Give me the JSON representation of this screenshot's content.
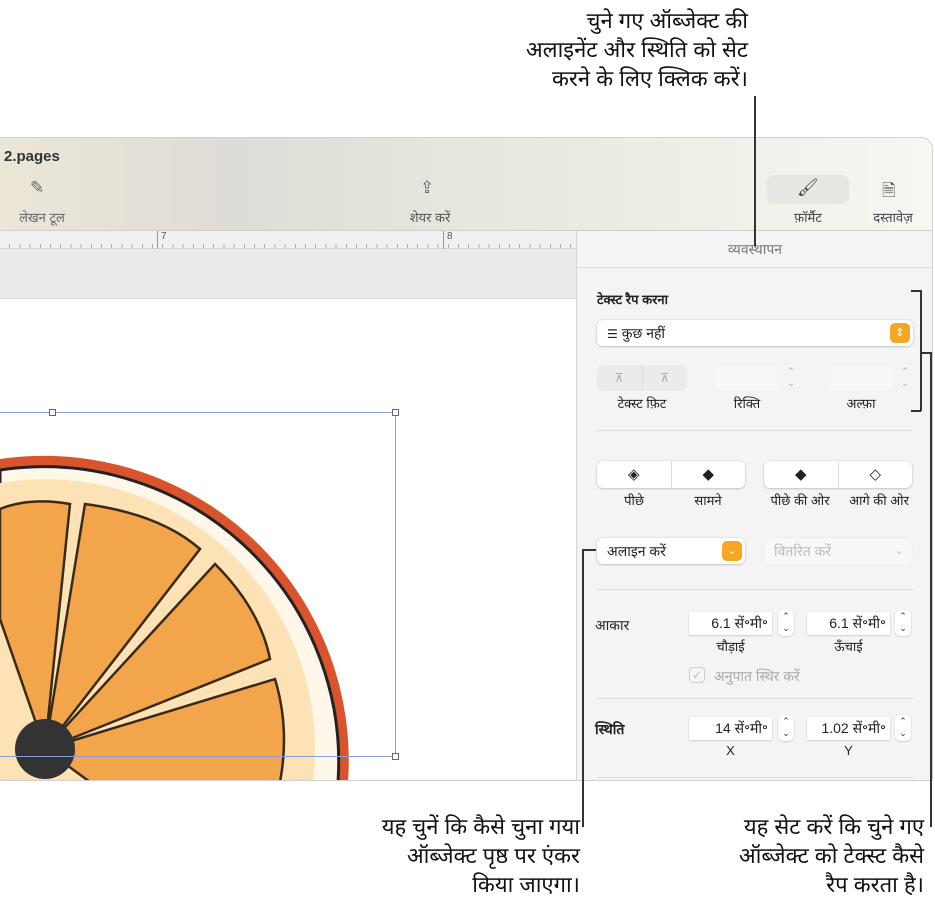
{
  "callouts": {
    "top": [
      "चुने गए ऑब्जेक्ट की",
      "अलाइनेंट और स्थिति को सेट",
      "करने के लिए क्लिक करें।"
    ],
    "bottom_left": [
      "यह चुनें कि कैसे चुना गया",
      "ऑब्जेक्ट पृष्ठ पर एंकर",
      "किया जाएगा।"
    ],
    "bottom_right": [
      "यह सेट करें कि चुने गए",
      "ऑब्जेक्ट को टेक्स्ट कैसे",
      "रैप करता है।"
    ]
  },
  "window": {
    "title": "2.pages"
  },
  "toolbar": {
    "writing_tools": "लेखन टूल",
    "share": "शेयर करें",
    "format": "फ़ॉर्मैट",
    "document": "दस्तावेज़"
  },
  "ruler": {
    "ticks": [
      "7",
      "8"
    ]
  },
  "sidebar": {
    "tab": "व्यवस्थापन",
    "text_wrap": {
      "heading": "टेक्स्ट रैप करना",
      "value": "कुछ नहीं",
      "text_fit": "टेक्स्ट फ़िट",
      "spacing": "रिक्ति",
      "alpha": "अल्फ़ा"
    },
    "arrange": {
      "back": "पीछे",
      "front": "सामने",
      "backward": "पीछे की ओर",
      "forward": "आगे की ओर"
    },
    "align": "अलाइन करें",
    "distribute": "वितरित करें",
    "size": {
      "label": "आकार",
      "width": "6.1 सें॰मी॰",
      "height": "6.1 सें॰मी॰",
      "width_label": "चौड़ाई",
      "height_label": "ऊँचाई",
      "constrain": "अनुपात स्थिर करें"
    },
    "position": {
      "label": "स्थिति",
      "x": "14 सें॰मी॰",
      "y": "1.02 सें॰मी॰",
      "x_label": "X",
      "y_label": "Y"
    }
  },
  "colors": {
    "accent": "#f5a623"
  }
}
